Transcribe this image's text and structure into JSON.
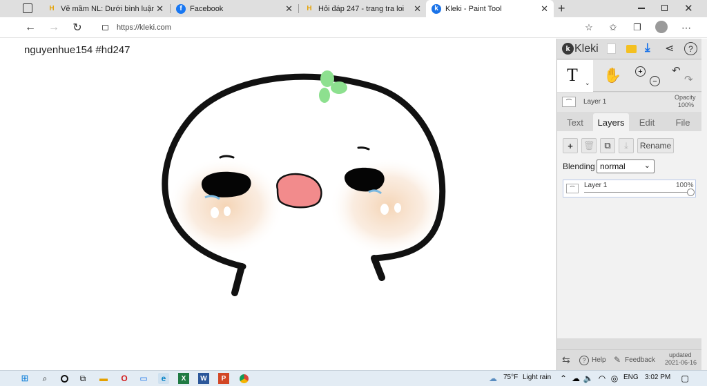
{
  "browser": {
    "tabs": [
      {
        "title": "Vẽ mầm NL: Dưới bình luận câu",
        "favicon": "H"
      },
      {
        "title": "Facebook",
        "favicon": "f"
      },
      {
        "title": "Hỏi đáp 247 - trang tra loi",
        "favicon": "H"
      },
      {
        "title": "Kleki - Paint Tool",
        "favicon": "k"
      }
    ],
    "url": "https://kleki.com"
  },
  "canvas": {
    "watermark": "nguyenhue154  #hd247"
  },
  "panel": {
    "brand": "Kleki",
    "layer_bar": {
      "name": "Layer 1",
      "opacity_label": "Opacity",
      "opacity_value": "100%"
    },
    "tabs": [
      "Text",
      "Layers",
      "Edit",
      "File"
    ],
    "rename_label": "Rename",
    "blending_label": "Blending",
    "blending_value": "normal",
    "layer_item": {
      "name": "Layer 1",
      "opacity": "100%",
      "opacity_fraction": 1.0
    },
    "footer": {
      "help": "Help",
      "feedback": "Feedback",
      "updated_label": "updated",
      "updated_date": "2021-06-16"
    }
  },
  "taskbar": {
    "weather_temp": "75°F",
    "weather_desc": "Light rain",
    "lang": "ENG",
    "time": "3:02 PM"
  },
  "colors": {
    "accent_blue": "#1a73e8",
    "leaf_green": "#8de08f",
    "mouth_pink": "#f28b8c",
    "blush": "#f6dcc4"
  }
}
